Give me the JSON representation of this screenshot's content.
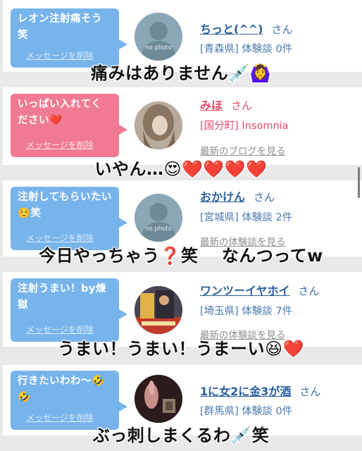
{
  "posts": [
    {
      "message": "レオン注射痛そう笑",
      "delete_label": "メッセージを削除",
      "user": "ちっと(^^)",
      "honorific": "さん",
      "meta": "[青森県] 体験談 0件",
      "blog": "",
      "avatar": "no photo",
      "caption": "痛みはありません💉🙆‍♀️"
    },
    {
      "message": "いっぱい入れてください❤️",
      "delete_label": "メッセージを削除",
      "user": "みほ",
      "honorific": "さん",
      "meta": "[国分町] Insomnia",
      "blog": "最新のブログを見る",
      "avatar": "",
      "caption": "いやん…😍❤️❤️❤️❤️"
    },
    {
      "message": "注射してもらいたい☺️笑",
      "delete_label": "メッセージを削除",
      "user": "おかけん",
      "honorific": "さん",
      "meta": "[宮城県] 体験談 2件",
      "blog": "最新の体験談を見る",
      "avatar": "no photo",
      "caption": "今日やっちゃう❓笑　 なんつってw"
    },
    {
      "message": "注射うまい！by煉獄",
      "delete_label": "メッセージを削除",
      "user": "ワンツーイヤホイ",
      "honorific": "さん",
      "meta": "[埼玉県] 体験談 7件",
      "blog": "最新の体験談を見る",
      "avatar": "",
      "caption": "うまい！うまい！うまーい😆❤️"
    },
    {
      "message": "行きたいわわ〜🤣🤣",
      "delete_label": "メッセージを削除",
      "user": "1に女2に金3が酒",
      "honorific": "さん",
      "meta": "[群馬県] 体験談 0件",
      "blog": "",
      "avatar": "",
      "caption": "ぶっ刺しまくるわ💉笑"
    }
  ],
  "colors": {
    "bubble_blue": "#78b4ec",
    "bubble_pink": "#f07a91",
    "link_blue": "#2a5f9e",
    "link_pink": "#e24b69",
    "background": "#e9e9eb"
  }
}
